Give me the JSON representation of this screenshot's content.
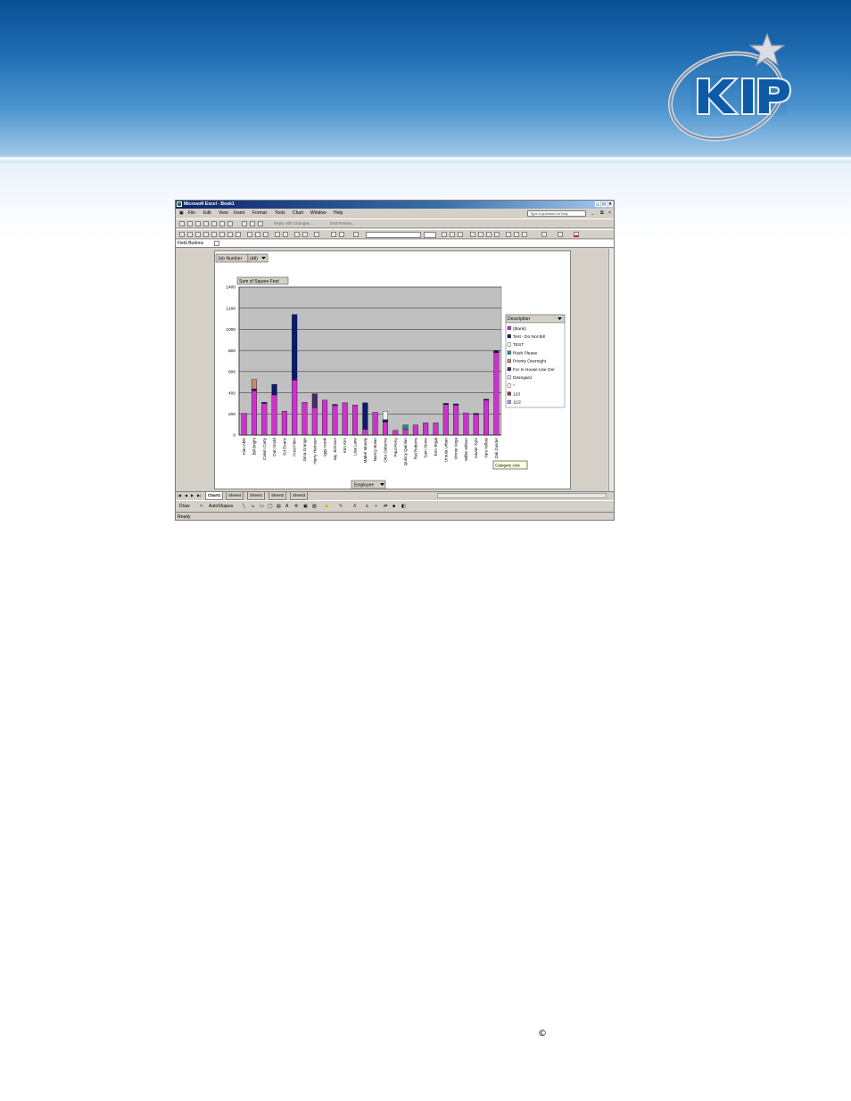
{
  "window": {
    "title": "Microsoft Excel - Book1",
    "help_placeholder": "Type a question for help"
  },
  "menu": [
    "File",
    "Edit",
    "View",
    "Insert",
    "Format",
    "Tools",
    "Chart",
    "Window",
    "Help"
  ],
  "toolbar": {
    "reply_with_changes": "Reply with Changes...",
    "end_review": "End Review..."
  },
  "field_buttons_label": "Field Buttons",
  "pivot": {
    "page_field": "Job Number",
    "page_value": "(All)",
    "data_field": "Sum of Square Feet",
    "series_field": "Description",
    "category_field": "Employee",
    "category_axis_tooltip": "Category Axis"
  },
  "sheet_tabs": [
    "Chart1",
    "Sheet4",
    "Sheet1",
    "Sheet2",
    "Sheet3"
  ],
  "draw_bar": {
    "draw": "Draw",
    "autoshapes": "AutoShapes"
  },
  "status": "Ready",
  "copyright_symbol": "©",
  "colors": {
    "plot_background": "#c0c0c0",
    "blank": "#cc33cc",
    "test_do_not_bill": "#0b1a6e",
    "test": "#ffffff",
    "rush_please": "#1c8a9a",
    "priority_overnight": "#d08a70",
    "for_in_house_use_only": "#4a2a6a",
    "disregard": "#e8f6e8"
  },
  "chart_data": {
    "type": "bar",
    "stacked": true,
    "title": "",
    "xlabel": "Employee",
    "ylabel": "Sum of Square Feet",
    "ylim": [
      0,
      1400
    ],
    "yticks": [
      0,
      200,
      400,
      600,
      800,
      1000,
      1200,
      1400
    ],
    "grid": true,
    "legend_title": "Description",
    "legend_position": "right",
    "legend": [
      {
        "name": "(blank)",
        "color": "#cc33cc"
      },
      {
        "name": "Test - Do Not Bill",
        "color": "#0b1a6e"
      },
      {
        "name": "TEST",
        "color": "#ffffff"
      },
      {
        "name": "Rush Please",
        "color": "#1c8a9a"
      },
      {
        "name": "Priority Overnight",
        "color": "#d08a70"
      },
      {
        "name": "For In House Use Onl",
        "color": "#4a2a6a"
      },
      {
        "name": "Disregard",
        "color": "#e8f6e8"
      },
      {
        "name": "*",
        "color": "#ffffff"
      },
      {
        "name": "123",
        "color": "#8a3a4a"
      },
      {
        "name": "11/2",
        "color": "#a0a0ff"
      }
    ],
    "categories": [
      "Alan Able",
      "Bill Bright",
      "Calvin Carty",
      "Dan Dodd",
      "Ed Evans",
      "Fred Flinn",
      "Gina Grange",
      "Harry Hamsun",
      "Iggy Isook",
      "Jay Johnson",
      "Kim Kim",
      "Lisa Lane",
      "Mabel Mosely",
      "Nancy Nolan",
      "Otto Osborne",
      "Paul Perry",
      "Quincy Quinlan",
      "Ral Roberts",
      "Sam Stone",
      "Tom Tegal",
      "Ursula Urban",
      "Vinnie Vega",
      "Willie Wilson",
      "Xavier Xylo",
      "Yani Yellow",
      "Zak Zander"
    ],
    "series": [
      {
        "name": "(blank)",
        "color": "#cc33cc",
        "values": [
          205,
          420,
          300,
          380,
          225,
          520,
          310,
          260,
          330,
          280,
          305,
          285,
          55,
          215,
          125,
          45,
          55,
          95,
          115,
          115,
          290,
          285,
          210,
          195,
          330,
          780
        ]
      },
      {
        "name": "Test - Do Not Bill",
        "color": "#0b1a6e",
        "values": [
          0,
          15,
          10,
          100,
          0,
          620,
          0,
          0,
          0,
          10,
          0,
          0,
          250,
          0,
          20,
          0,
          0,
          0,
          0,
          0,
          10,
          10,
          0,
          10,
          10,
          20
        ]
      },
      {
        "name": "TEST",
        "color": "#ffffff",
        "values": [
          0,
          0,
          0,
          0,
          0,
          0,
          0,
          0,
          0,
          0,
          0,
          0,
          0,
          0,
          0,
          0,
          0,
          0,
          0,
          0,
          0,
          0,
          0,
          0,
          0,
          0
        ]
      },
      {
        "name": "Rush Please",
        "color": "#1c8a9a",
        "values": [
          0,
          0,
          0,
          0,
          0,
          0,
          0,
          0,
          0,
          0,
          0,
          0,
          0,
          0,
          0,
          0,
          40,
          0,
          0,
          0,
          0,
          0,
          0,
          0,
          0,
          0
        ]
      },
      {
        "name": "Priority Overnight",
        "color": "#d08a70",
        "values": [
          0,
          90,
          0,
          0,
          0,
          0,
          0,
          0,
          0,
          0,
          0,
          0,
          0,
          0,
          0,
          0,
          0,
          0,
          0,
          0,
          0,
          0,
          0,
          0,
          0,
          0
        ]
      },
      {
        "name": "For In House Use Onl",
        "color": "#4a2a6a",
        "values": [
          0,
          0,
          0,
          0,
          0,
          0,
          0,
          130,
          0,
          0,
          0,
          0,
          0,
          0,
          0,
          0,
          0,
          0,
          0,
          0,
          0,
          0,
          0,
          0,
          0,
          0
        ]
      },
      {
        "name": "Disregard",
        "color": "#e8f6e8",
        "values": [
          0,
          0,
          0,
          0,
          0,
          0,
          0,
          0,
          0,
          0,
          0,
          0,
          0,
          0,
          80,
          0,
          0,
          0,
          0,
          0,
          0,
          0,
          0,
          0,
          0,
          0
        ]
      }
    ]
  }
}
